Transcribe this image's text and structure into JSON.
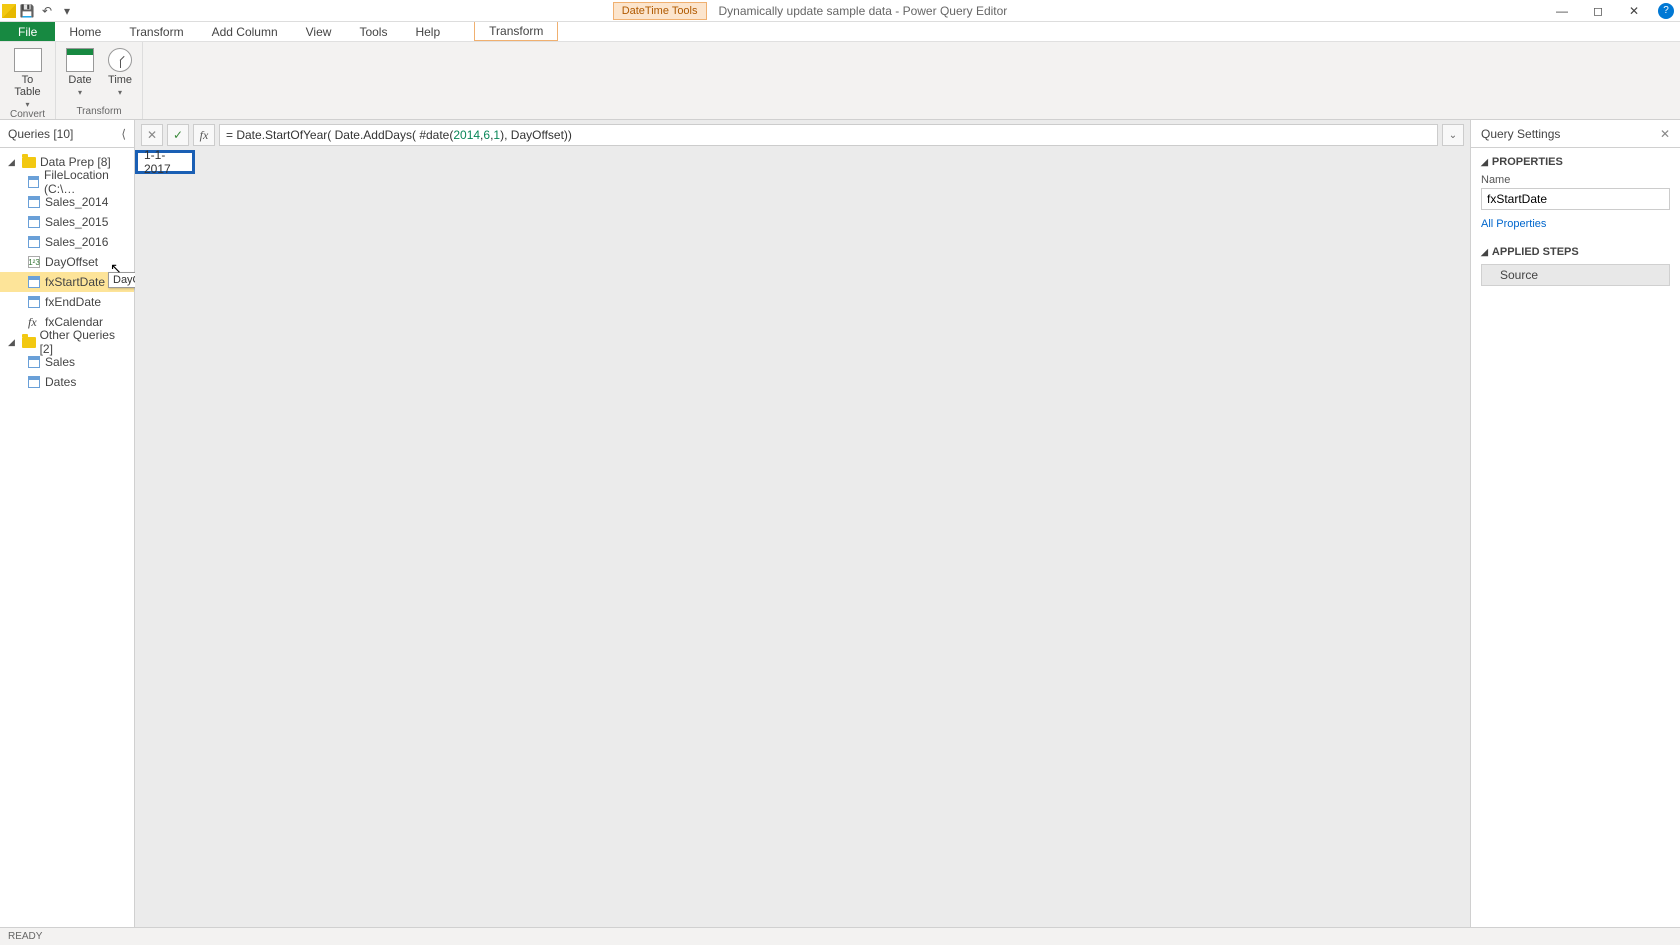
{
  "titlebar": {
    "context_tab": "DateTime Tools",
    "title": "Dynamically update sample data - Power Query Editor"
  },
  "menu": {
    "file": "File",
    "items": [
      "Home",
      "Transform",
      "Add Column",
      "View",
      "Tools",
      "Help"
    ],
    "context": "Transform"
  },
  "ribbon": {
    "convert": {
      "to_table": "To\nTable",
      "dropdown": "▾",
      "group_label": "Convert"
    },
    "transform": {
      "date": "Date",
      "time": "Time",
      "group_label": "Transform"
    }
  },
  "queries_pane": {
    "header": "Queries [10]",
    "folders": [
      {
        "name": "Data Prep [8]",
        "items": [
          {
            "icon": "tbl",
            "label": "FileLocation (C:\\…"
          },
          {
            "icon": "tbl",
            "label": "Sales_2014"
          },
          {
            "icon": "tbl",
            "label": "Sales_2015"
          },
          {
            "icon": "tbl",
            "label": "Sales_2016"
          },
          {
            "icon": "num",
            "label": "DayOffset"
          },
          {
            "icon": "tbl",
            "label": "fxStartDate",
            "selected": true
          },
          {
            "icon": "tbl",
            "label": "fxEndDate"
          },
          {
            "icon": "fx",
            "label": "fxCalendar"
          }
        ]
      },
      {
        "name": "Other Queries [2]",
        "items": [
          {
            "icon": "tbl",
            "label": "Sales"
          },
          {
            "icon": "tbl",
            "label": "Dates"
          }
        ]
      }
    ],
    "tooltip": "DayOffset"
  },
  "formula": {
    "prefix": "= Date.StartOfYear( Date.AddDays( #date(",
    "y": "2014",
    "mid1": ", ",
    "m": "6",
    "mid2": ",",
    "d": "1",
    "suffix": "), DayOffset))"
  },
  "preview_value": "1-1-2017",
  "settings": {
    "header": "Query Settings",
    "properties_title": "PROPERTIES",
    "name_label": "Name",
    "name_value": "fxStartDate",
    "all_props": "All Properties",
    "steps_title": "APPLIED STEPS",
    "steps": [
      "Source"
    ]
  },
  "status": "READY"
}
